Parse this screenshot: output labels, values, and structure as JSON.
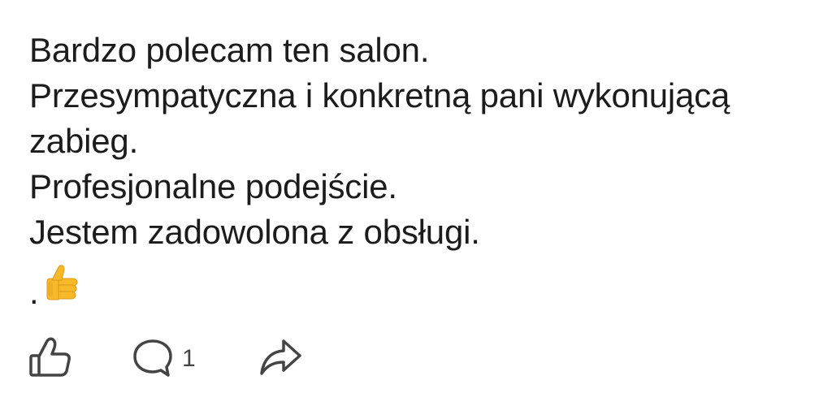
{
  "post": {
    "lines": [
      "Bardzo polecam ten salon.",
      "Przesympatyczna i konkretną pani wykonującą",
      "zabieg.",
      "Profesjonalne podejście.",
      "Jestem zadowolona z obsługi."
    ],
    "dot": ".",
    "emoji": "thumbs-up"
  },
  "actions": {
    "like_icon": "thumbs-up-outline-icon",
    "comment_icon": "speech-bubble-icon",
    "comment_count": "1",
    "share_icon": "share-arrow-icon"
  },
  "colors": {
    "text": "#1c1c1c",
    "icon": "#444444",
    "emoji_yellow": "#f7b928",
    "background": "#ffffff"
  }
}
